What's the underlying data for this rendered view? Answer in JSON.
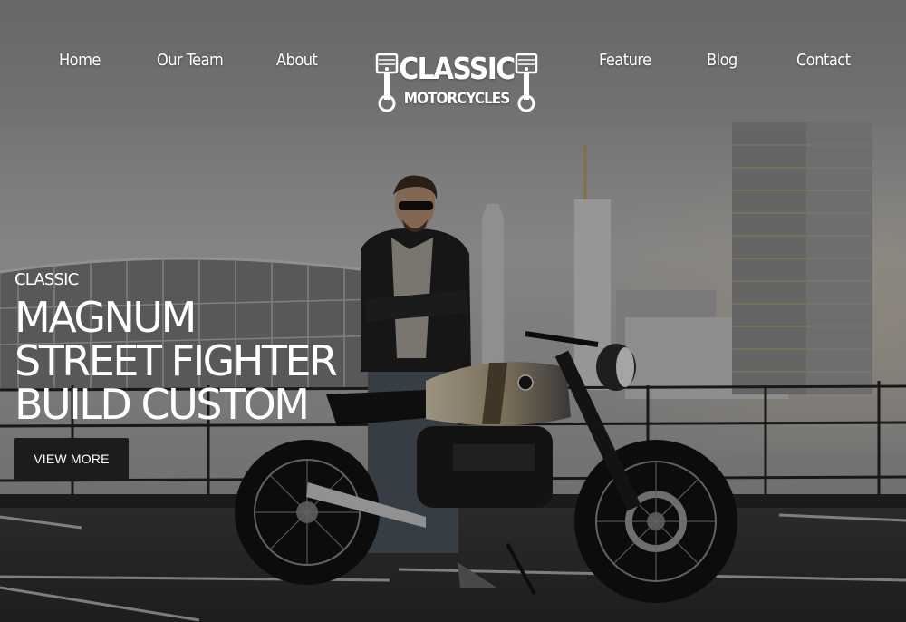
{
  "nav": {
    "left": [
      {
        "label": "Home"
      },
      {
        "label": "Our Team"
      },
      {
        "label": "About"
      }
    ],
    "right": [
      {
        "label": "Feature"
      },
      {
        "label": "Blog"
      },
      {
        "label": "Contact"
      }
    ]
  },
  "logo": {
    "line1": "CLASSIC",
    "line2": "MOTORCYCLES",
    "icons": [
      "piston-icon",
      "piston-icon"
    ]
  },
  "hero": {
    "kicker": "CLASSIC",
    "headline": [
      "MAGNUM",
      "STREET FIGHTER",
      "BUILD CUSTOM"
    ],
    "button_label": "VIEW MORE"
  },
  "colors": {
    "overlay": "#3d3d3d",
    "sky": "#b9b9b9",
    "button": "#1c1c1c",
    "text": "#ffffff"
  }
}
